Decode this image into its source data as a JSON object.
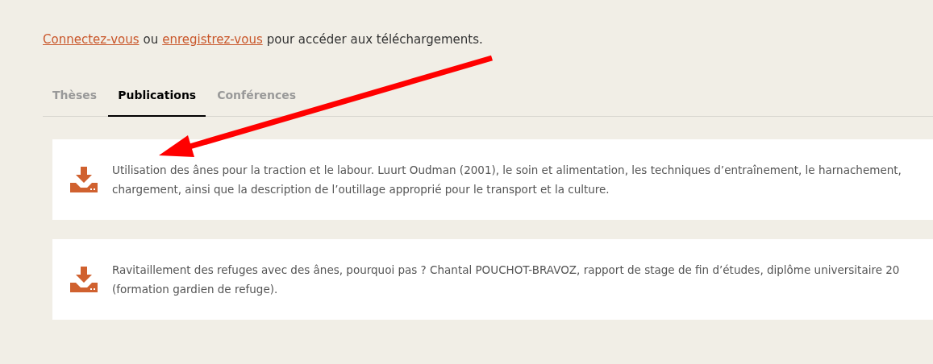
{
  "notice": {
    "login_link": "Connectez-vous",
    "separator": "ou",
    "register_link": "enregistrez-vous",
    "rest": "pour accéder aux téléchargements."
  },
  "tabs": [
    {
      "label": "Thèses",
      "selected": false
    },
    {
      "label": "Publications",
      "selected": true
    },
    {
      "label": "Conférences",
      "selected": false
    }
  ],
  "publications": [
    {
      "lines": [
        "Utilisation des ânes pour la traction et le labour. Luurt Oudman (2001), le soin et alimentation, les techniques d’entraînement, le harnachement,",
        "chargement, ainsi que la description de l’outillage approprié pour le transport et la culture."
      ]
    },
    {
      "lines": [
        "Ravitaillement des refuges avec des ânes, pourquoi pas ? Chantal POUCHOT-BRAVOZ, rapport de stage de fin d’études, diplôme universitaire 20",
        "(formation gardien de refuge)."
      ]
    }
  ]
}
